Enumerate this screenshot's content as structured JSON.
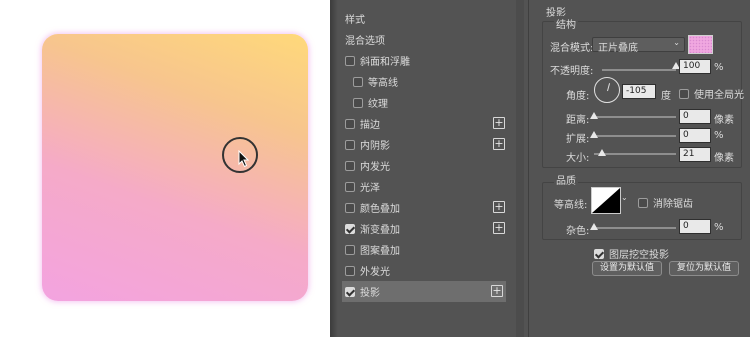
{
  "styles_panel": {
    "header": "样式",
    "blend_options": "混合选项",
    "items": [
      {
        "label": "斜面和浮雕",
        "checked": false,
        "indent": false,
        "plus": false
      },
      {
        "label": "等高线",
        "checked": false,
        "indent": true,
        "plus": false
      },
      {
        "label": "纹理",
        "checked": false,
        "indent": true,
        "plus": false
      },
      {
        "label": "描边",
        "checked": false,
        "indent": false,
        "plus": true
      },
      {
        "label": "内阴影",
        "checked": false,
        "indent": false,
        "plus": true
      },
      {
        "label": "内发光",
        "checked": false,
        "indent": false,
        "plus": false
      },
      {
        "label": "光泽",
        "checked": false,
        "indent": false,
        "plus": false
      },
      {
        "label": "颜色叠加",
        "checked": false,
        "indent": false,
        "plus": true
      },
      {
        "label": "渐变叠加",
        "checked": true,
        "indent": false,
        "plus": true
      },
      {
        "label": "图案叠加",
        "checked": false,
        "indent": false,
        "plus": false
      },
      {
        "label": "外发光",
        "checked": false,
        "indent": false,
        "plus": false
      },
      {
        "label": "投影",
        "checked": true,
        "indent": false,
        "plus": true,
        "selected": true
      }
    ],
    "plus_symbol": "+"
  },
  "drop_shadow": {
    "title": "投影",
    "structure": {
      "title": "结构",
      "blend_mode_label": "混合模式:",
      "blend_mode_value": "正片叠底",
      "shadow_color": "#f0a7e0",
      "opacity_label": "不透明度:",
      "opacity_value": "100",
      "opacity_unit": "%",
      "opacity_level": 1.0,
      "angle_label": "角度:",
      "angle_value": "-105",
      "angle_unit": "度",
      "global_light_label": "使用全局光",
      "global_light_checked": false,
      "distance_label": "距离:",
      "distance_value": "0",
      "distance_unit": "像素",
      "distance_level": 0,
      "spread_label": "扩展:",
      "spread_value": "0",
      "spread_unit": "%",
      "spread_level": 0,
      "size_label": "大小:",
      "size_value": "21",
      "size_unit": "像素",
      "size_level": 0.1
    },
    "quality": {
      "title": "品质",
      "contour_label": "等高线:",
      "antialias_label": "消除锯齿",
      "antialias_checked": false,
      "noise_label": "杂色:",
      "noise_value": "0",
      "noise_unit": "%",
      "noise_level": 0
    },
    "knockout_label": "图层挖空投影",
    "knockout_checked": true,
    "set_default_button": "设置为默认值",
    "reset_default_button": "复位为默认值"
  },
  "colors": {
    "dialog_bg": "#535353",
    "selected_row": "#6e6e6e",
    "gradient_top": "#ffd97a",
    "gradient_bottom": "#f3a3e0"
  }
}
